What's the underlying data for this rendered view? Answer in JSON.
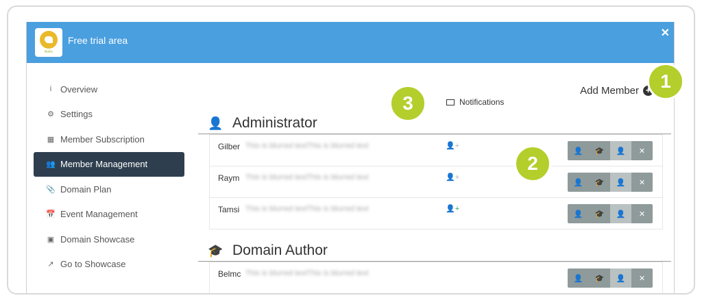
{
  "window": {
    "title": "Free trial area",
    "logo_text": "Bellis"
  },
  "sidebar": {
    "items": [
      {
        "label": "Overview",
        "icon": "info-icon",
        "glyph": "i",
        "active": false
      },
      {
        "label": "Settings",
        "icon": "gear-icon",
        "glyph": "⚙",
        "active": false
      },
      {
        "label": "Member Subscription",
        "icon": "qr-icon",
        "glyph": "▦",
        "active": false
      },
      {
        "label": "Member Management",
        "icon": "users-icon",
        "glyph": "👥",
        "active": true
      },
      {
        "label": "Domain Plan",
        "icon": "paperclip-icon",
        "glyph": "📎",
        "active": false
      },
      {
        "label": "Event Management",
        "icon": "calendar-icon",
        "glyph": "📅",
        "active": false
      },
      {
        "label": "Domain Showcase",
        "icon": "id-card-icon",
        "glyph": "▣",
        "active": false
      },
      {
        "label": "Go to Showcase",
        "icon": "external-link-icon",
        "glyph": "↗",
        "active": false
      }
    ]
  },
  "main": {
    "add_member_label": "Add Member",
    "notifications_label": "Notifications",
    "sections": [
      {
        "title": "Administrator",
        "icon": "user-shield-icon",
        "members": [
          {
            "name": "Gilber",
            "blurred": "This is blurred textThis is blurred text",
            "notify": false
          },
          {
            "name": "Raym",
            "blurred": "This is blurred textThis is blurred text",
            "notify": false
          },
          {
            "name": "Tamsi",
            "blurred": "This is blurred textThis is blurred text",
            "notify": true
          }
        ]
      },
      {
        "title": "Domain Author",
        "icon": "graduate-icon",
        "members": [
          {
            "name": "Belmc",
            "blurred": "This is blurred textThis is blurred text",
            "notify": null
          }
        ]
      }
    ]
  },
  "badges": [
    "1",
    "2",
    "3"
  ],
  "colors": {
    "titlebar": "#4a9fdf",
    "active_nav": "#2e3e4e",
    "badge": "#b4ce2c",
    "notify_on": "#2aa36b",
    "action_btn": "#8f9a9a"
  }
}
